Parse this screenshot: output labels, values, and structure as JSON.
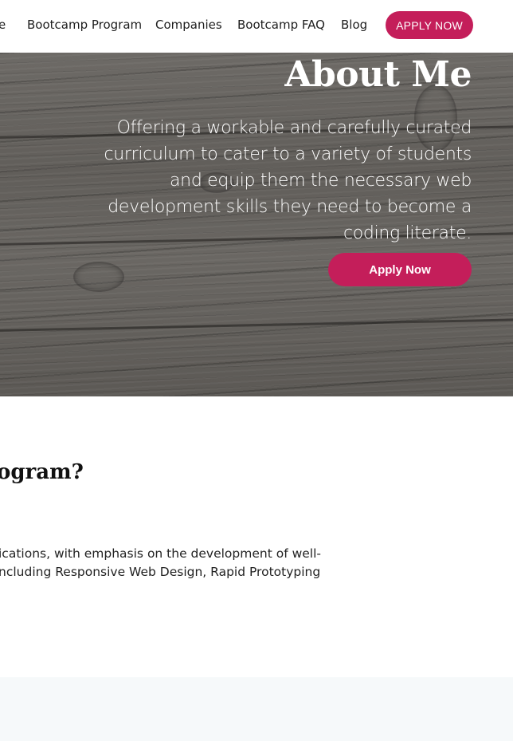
{
  "nav": {
    "items": [
      {
        "label": "e"
      },
      {
        "label": "Bootcamp Program"
      },
      {
        "label": "Companies"
      },
      {
        "label": "Bootcamp FAQ"
      },
      {
        "label": "Blog"
      }
    ],
    "cta_label": "APPLY NOW"
  },
  "hero": {
    "title": "About Me",
    "description": "Offering a workable and carefully curated curriculum to cater to a variety of students and equip them the necessary web development skills they need to become a coding literate.",
    "cta_label": "Apply Now"
  },
  "section": {
    "heading": "ogram?",
    "body_lines": [
      "ications, with emphasis on the development of well-",
      "ncluding Responsive Web Design, Rapid Prototyping"
    ]
  },
  "colors": {
    "accent": "#c41e5a",
    "hero_wood": "#6a6763",
    "footer_band": "#f6f9fa"
  }
}
